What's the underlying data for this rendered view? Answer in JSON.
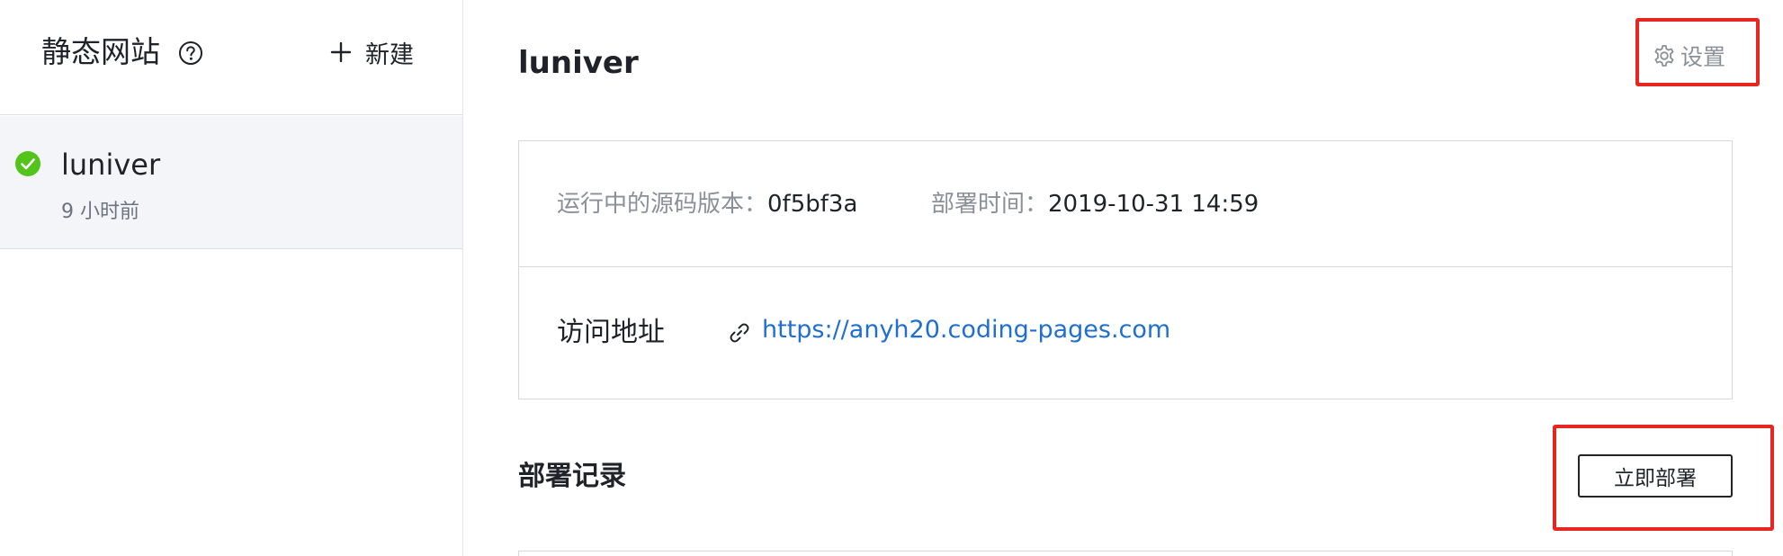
{
  "sidebar": {
    "title": "静态网站",
    "help_icon": "question-circle-icon",
    "new_label": "新建",
    "new_icon": "plus-icon",
    "items": [
      {
        "name": "luniver",
        "time": "9 小时前",
        "status": "success",
        "status_icon": "check-circle-icon",
        "status_color": "#52c41a"
      }
    ]
  },
  "main": {
    "title": "luniver",
    "settings_label": "设置",
    "settings_icon": "gear-icon",
    "info": {
      "version_label": "运行中的源码版本：",
      "version_value": "0f5bf3a",
      "deploy_time_label": "部署时间：",
      "deploy_time_value": "2019-10-31 14:59",
      "visit_label": "访问地址",
      "visit_icon": "link-icon",
      "visit_url": "https://anyh20.coding-pages.com"
    },
    "deploy_records": {
      "title": "部署记录",
      "deploy_now_label": "立即部署"
    }
  },
  "colors": {
    "accent_link": "#1f6fd1",
    "success": "#52c41a",
    "annotation": "#e8251e",
    "muted_text": "#8a9099"
  }
}
